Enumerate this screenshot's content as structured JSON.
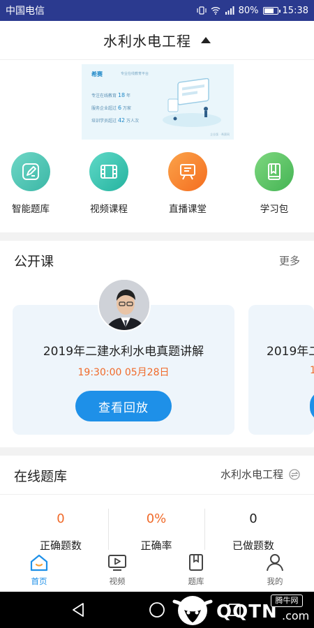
{
  "status_bar": {
    "carrier": "中国电信",
    "battery": "80%",
    "battery_level": 0.8,
    "time": "15:38"
  },
  "header": {
    "title": "水利水电工程"
  },
  "banner": {
    "logo": "希赛",
    "slogan": "专业在线教育平台",
    "lines": [
      {
        "pre": "专注在线教育",
        "num": "18",
        "post": "年"
      },
      {
        "pre": "服务企业超过",
        "num": "6",
        "post": "万家"
      },
      {
        "pre": "培训学员超过",
        "num": "42",
        "post": "万人次"
      }
    ],
    "foot": "企业版 · 希赛网"
  },
  "categories": [
    {
      "label": "智能题库",
      "icon": "pencil-icon",
      "color": "#4fc7b8"
    },
    {
      "label": "视频课程",
      "icon": "film-icon",
      "color": "#35c6b2"
    },
    {
      "label": "直播课堂",
      "icon": "live-board-icon",
      "color": "#f8862e"
    },
    {
      "label": "学习包",
      "icon": "book-icon",
      "color": "#5cc36a"
    }
  ],
  "open_course": {
    "title": "公开课",
    "more": "更多",
    "cards": [
      {
        "title": "2019年二建水利水电真题讲解",
        "time": "19:30:00  05月28日",
        "button": "查看回放"
      },
      {
        "title": "2019年二",
        "time": "1",
        "button": ""
      }
    ]
  },
  "question_bank": {
    "title": "在线题库",
    "subject": "水利水电工程",
    "stats": [
      {
        "value": "0",
        "label": "正确题数",
        "color": "#f06a2a"
      },
      {
        "value": "0%",
        "label": "正确率",
        "color": "#f06a2a"
      },
      {
        "value": "0",
        "label": "已做题数",
        "color": "#222222"
      }
    ]
  },
  "tabs": [
    {
      "label": "首页",
      "icon": "home-icon",
      "active": true
    },
    {
      "label": "视频",
      "icon": "video-icon",
      "active": false
    },
    {
      "label": "题库",
      "icon": "question-bank-icon",
      "active": false
    },
    {
      "label": "我的",
      "icon": "profile-icon",
      "active": false
    }
  ],
  "watermark": {
    "brand": "QQTN",
    "suffix": ".com",
    "tag": "腾牛网"
  },
  "colors": {
    "accent": "#1e90e8",
    "highlight": "#f06a2a",
    "status_bar": "#2b3a8f"
  }
}
